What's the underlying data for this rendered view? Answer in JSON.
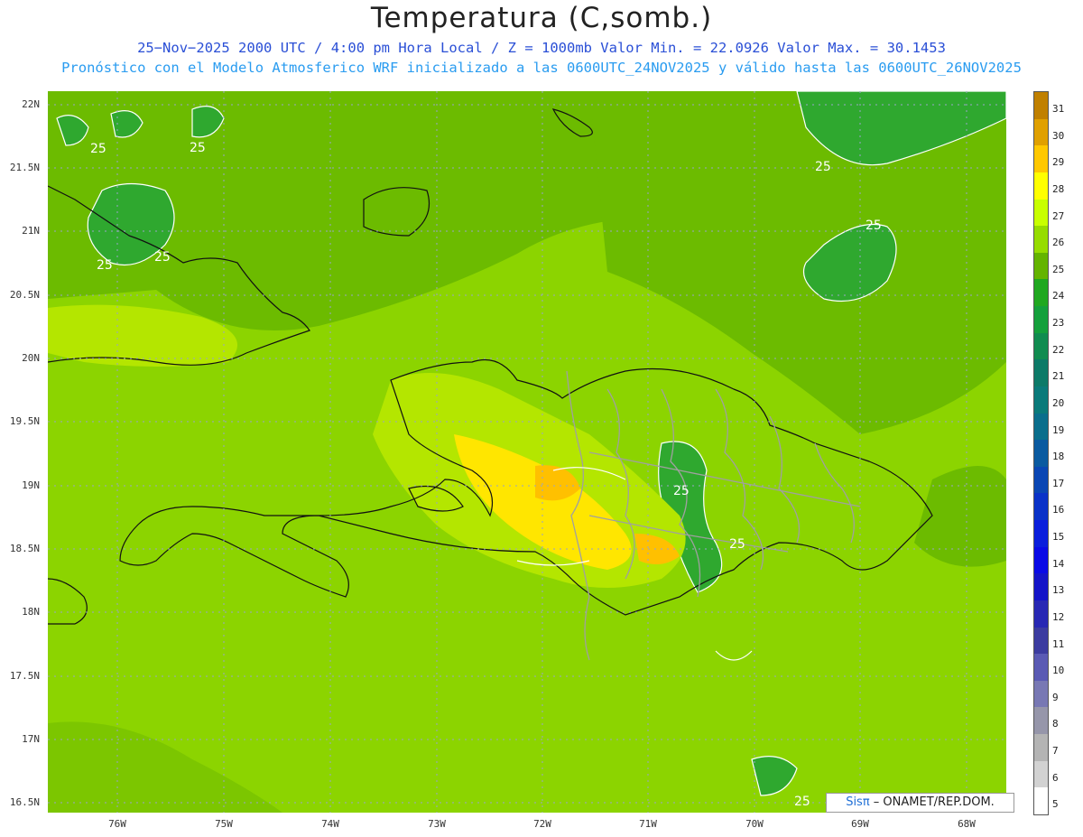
{
  "header": {
    "title": "Temperatura (C,somb.)",
    "line1": "25−Nov−2025  2000 UTC / 4:00 pm Hora Local / Z = 1000mb   Valor Min. = 22.0926  Valor Max. = 30.1453",
    "line2": "Pronóstico con el Modelo Atmosferico WRF inicializado a las 0600UTC_24NOV2025 y válido hasta las  0600UTC_26NOV2025"
  },
  "axes": {
    "lat_labels": [
      "22N",
      "21.5N",
      "21N",
      "20.5N",
      "20N",
      "19.5N",
      "19N",
      "18.5N",
      "18N",
      "17.5N",
      "17N",
      "16.5N"
    ],
    "lon_labels": [
      "76W",
      "75W",
      "74W",
      "73W",
      "72W",
      "71W",
      "70W",
      "69W",
      "68W"
    ]
  },
  "map": {
    "contour_labels": [
      "25",
      "25",
      "25",
      "25",
      "25",
      "25",
      "25",
      "25",
      "25",
      "25"
    ]
  },
  "colorbar": {
    "labels": [
      "31",
      "30",
      "29",
      "28",
      "27",
      "26",
      "25",
      "24",
      "23",
      "22",
      "21",
      "20",
      "19",
      "18",
      "17",
      "16",
      "15",
      "14",
      "13",
      "12",
      "11",
      "10",
      "9",
      "8",
      "7",
      "6",
      "5"
    ],
    "colors": [
      "#c08000",
      "#e0a000",
      "#ffc800",
      "#ffff00",
      "#c8ff00",
      "#96dc00",
      "#64b400",
      "#20a820",
      "#14a03c",
      "#108c50",
      "#0c7a68",
      "#0a7a7a",
      "#0a6e8c",
      "#0a5aa0",
      "#0a46b4",
      "#0a32c8",
      "#0a1edc",
      "#0a0ae6",
      "#1414c8",
      "#2828b4",
      "#3c3ca0",
      "#5a5ab4",
      "#7878b4",
      "#9696aa",
      "#b4b4b4",
      "#d2d2d2",
      "#ffffff"
    ]
  },
  "credit": {
    "brand": "Sisπ",
    "text": " – ONAMET/REP.DOM."
  }
}
